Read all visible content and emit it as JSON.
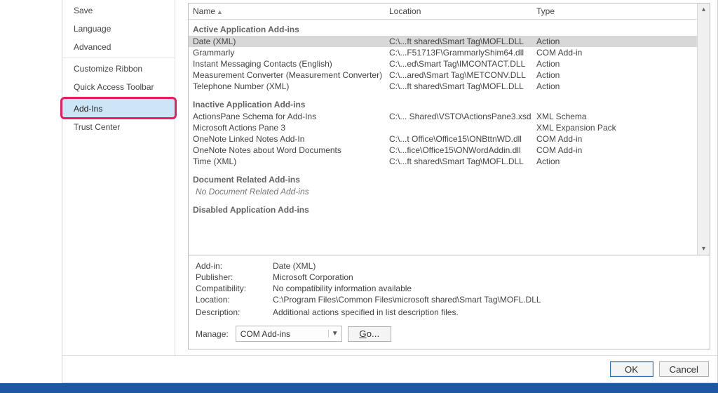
{
  "nav": {
    "items": [
      {
        "label": "Save"
      },
      {
        "label": "Language"
      },
      {
        "label": "Advanced"
      },
      {
        "label": "Customize Ribbon"
      },
      {
        "label": "Quick Access Toolbar"
      },
      {
        "label": "Add-Ins"
      },
      {
        "label": "Trust Center"
      }
    ],
    "selected_index": 5
  },
  "table": {
    "columns": {
      "name": "Name",
      "location": "Location",
      "type": "Type"
    },
    "groups": [
      {
        "title": "Active Application Add-ins",
        "rows": [
          {
            "name": "Date (XML)",
            "location": "C:\\...ft shared\\Smart Tag\\MOFL.DLL",
            "type": "Action",
            "selected": true
          },
          {
            "name": "Grammarly",
            "location": "C:\\...F51713F\\GrammarlyShim64.dll",
            "type": "COM Add-in"
          },
          {
            "name": "Instant Messaging Contacts (English)",
            "location": "C:\\...ed\\Smart Tag\\IMCONTACT.DLL",
            "type": "Action"
          },
          {
            "name": "Measurement Converter (Measurement Converter)",
            "location": "C:\\...ared\\Smart Tag\\METCONV.DLL",
            "type": "Action"
          },
          {
            "name": "Telephone Number (XML)",
            "location": "C:\\...ft shared\\Smart Tag\\MOFL.DLL",
            "type": "Action"
          }
        ]
      },
      {
        "title": "Inactive Application Add-ins",
        "rows": [
          {
            "name": "ActionsPane Schema for Add-Ins",
            "location": "C:\\... Shared\\VSTO\\ActionsPane3.xsd",
            "type": "XML Schema"
          },
          {
            "name": "Microsoft Actions Pane 3",
            "location": "",
            "type": "XML Expansion Pack"
          },
          {
            "name": "OneNote Linked Notes Add-In",
            "location": "C:\\...t Office\\Office15\\ONBttnWD.dll",
            "type": "COM Add-in"
          },
          {
            "name": "OneNote Notes about Word Documents",
            "location": "C:\\...fice\\Office15\\ONWordAddin.dll",
            "type": "COM Add-in"
          },
          {
            "name": "Time (XML)",
            "location": "C:\\...ft shared\\Smart Tag\\MOFL.DLL",
            "type": "Action"
          }
        ]
      },
      {
        "title": "Document Related Add-ins",
        "empty_text": "No Document Related Add-ins"
      },
      {
        "title": "Disabled Application Add-ins"
      }
    ]
  },
  "details": {
    "labels": {
      "addin": "Add-in:",
      "publisher": "Publisher:",
      "compatibility": "Compatibility:",
      "location": "Location:",
      "description": "Description:",
      "manage": "Manage:"
    },
    "values": {
      "addin": "Date (XML)",
      "publisher": "Microsoft Corporation",
      "compatibility": "No compatibility information available",
      "location": "C:\\Program Files\\Common Files\\microsoft shared\\Smart Tag\\MOFL.DLL",
      "description": "Additional actions specified in list description files."
    },
    "manage_value": "COM Add-ins",
    "go_label": "Go..."
  },
  "footer": {
    "ok": "OK",
    "cancel": "Cancel"
  }
}
